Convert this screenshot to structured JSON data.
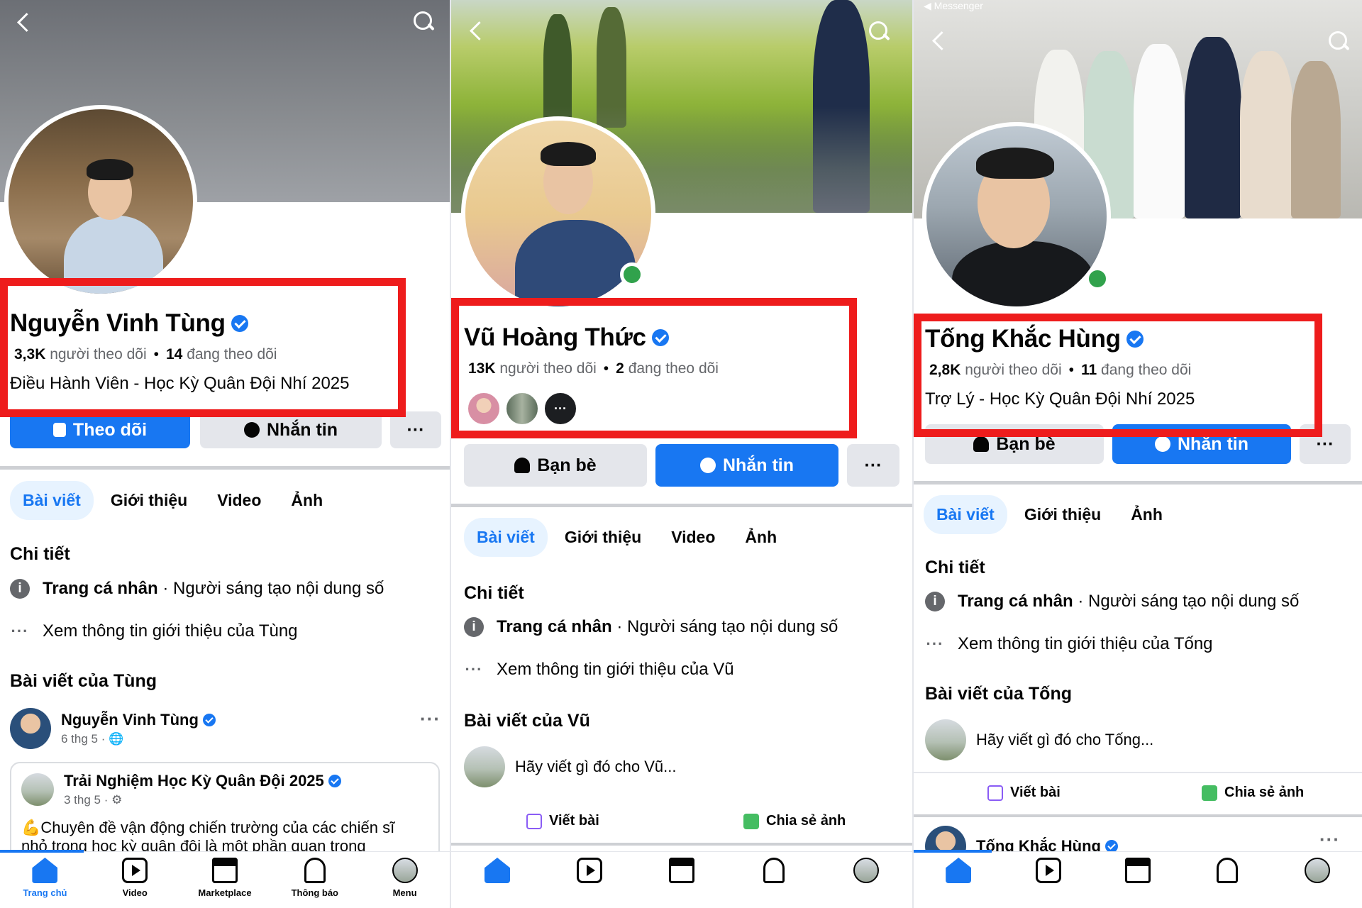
{
  "panels": [
    {
      "name": "Nguyễn Vinh Tùng",
      "followers_count": "3,3K",
      "followers_label": "người theo dõi",
      "following_count": "14",
      "following_label": "đang theo dõi",
      "bio": "Điều Hành Viên - Học Kỳ Quân Đội Nhí 2025",
      "primary_button": "Theo dõi",
      "secondary_button": "Nhắn tin",
      "more_button": "···",
      "tabs": [
        "Bài viết",
        "Giới thiệu",
        "Video",
        "Ảnh"
      ],
      "details_heading": "Chi tiết",
      "detail_page_type": "Trang cá nhân",
      "detail_category": " · Người sáng tạo nội dung số",
      "detail_more": "Xem thông tin giới thiệu của Tùng",
      "posts_heading": "Bài viết của Tùng",
      "post_author": "Nguyễn Vinh Tùng",
      "post_meta": "6 thg 5 · 🌐",
      "shared_author": "Trải Nghiệm Học Kỳ Quân Đội 2025",
      "shared_meta": "3 thg 5 · ⚙",
      "shared_text_1": "💪Chuyên đề vận động chiến trường của các chiến sĩ",
      "shared_text_2": "nhỏ trong học kỳ quân đội là một phần quan trọng"
    },
    {
      "name": "Vũ Hoàng Thức",
      "followers_count": "13K",
      "followers_label": "người theo dõi",
      "following_count": "2",
      "following_label": "đang theo dõi",
      "primary_button": "Bạn bè",
      "secondary_button": "Nhắn tin",
      "more_button": "···",
      "tabs": [
        "Bài viết",
        "Giới thiệu",
        "Video",
        "Ảnh"
      ],
      "details_heading": "Chi tiết",
      "detail_page_type": "Trang cá nhân",
      "detail_category": " · Người sáng tạo nội dung số",
      "detail_more": "Xem thông tin giới thiệu của Vũ",
      "posts_heading": "Bài viết của Vũ",
      "composer_placeholder": "Hãy viết gì đó cho Vũ...",
      "action_write": "Viết bài",
      "action_share_photo": "Chia sẻ ảnh"
    },
    {
      "name": "Tống Khắc Hùng",
      "followers_count": "2,8K",
      "followers_label": "người theo dõi",
      "following_count": "11",
      "following_label": "đang theo dõi",
      "bio": "Trợ Lý - Học Kỳ Quân Đội Nhí 2025",
      "primary_button": "Bạn bè",
      "secondary_button": "Nhắn tin",
      "more_button": "···",
      "tabs": [
        "Bài viết",
        "Giới thiệu",
        "Ảnh"
      ],
      "details_heading": "Chi tiết",
      "detail_page_type": "Trang cá nhân",
      "detail_category": " · Người sáng tạo nội dung số",
      "detail_more": "Xem thông tin giới thiệu của Tống",
      "posts_heading": "Bài viết của Tống",
      "composer_placeholder": "Hãy viết gì đó cho Tống...",
      "action_write": "Viết bài",
      "action_share_photo": "Chia sẻ ảnh",
      "post_author": "Tống Khắc Hùng",
      "top_left_label": "◀ Messenger"
    }
  ],
  "bottom_nav": [
    "Trang chủ",
    "Video",
    "Marketplace",
    "Thông báo",
    "Menu"
  ],
  "icons": [
    "back-icon",
    "search-icon",
    "verified-icon",
    "lock-icon",
    "messenger-icon",
    "friends-icon",
    "info-icon",
    "more-icon",
    "edit-icon",
    "photo-icon",
    "home-icon",
    "video-icon",
    "marketplace-icon",
    "bell-icon",
    "menu-icon"
  ],
  "colors": {
    "accent": "#1877f2",
    "highlight_box": "#ee1c1c",
    "online": "#31a24c"
  }
}
